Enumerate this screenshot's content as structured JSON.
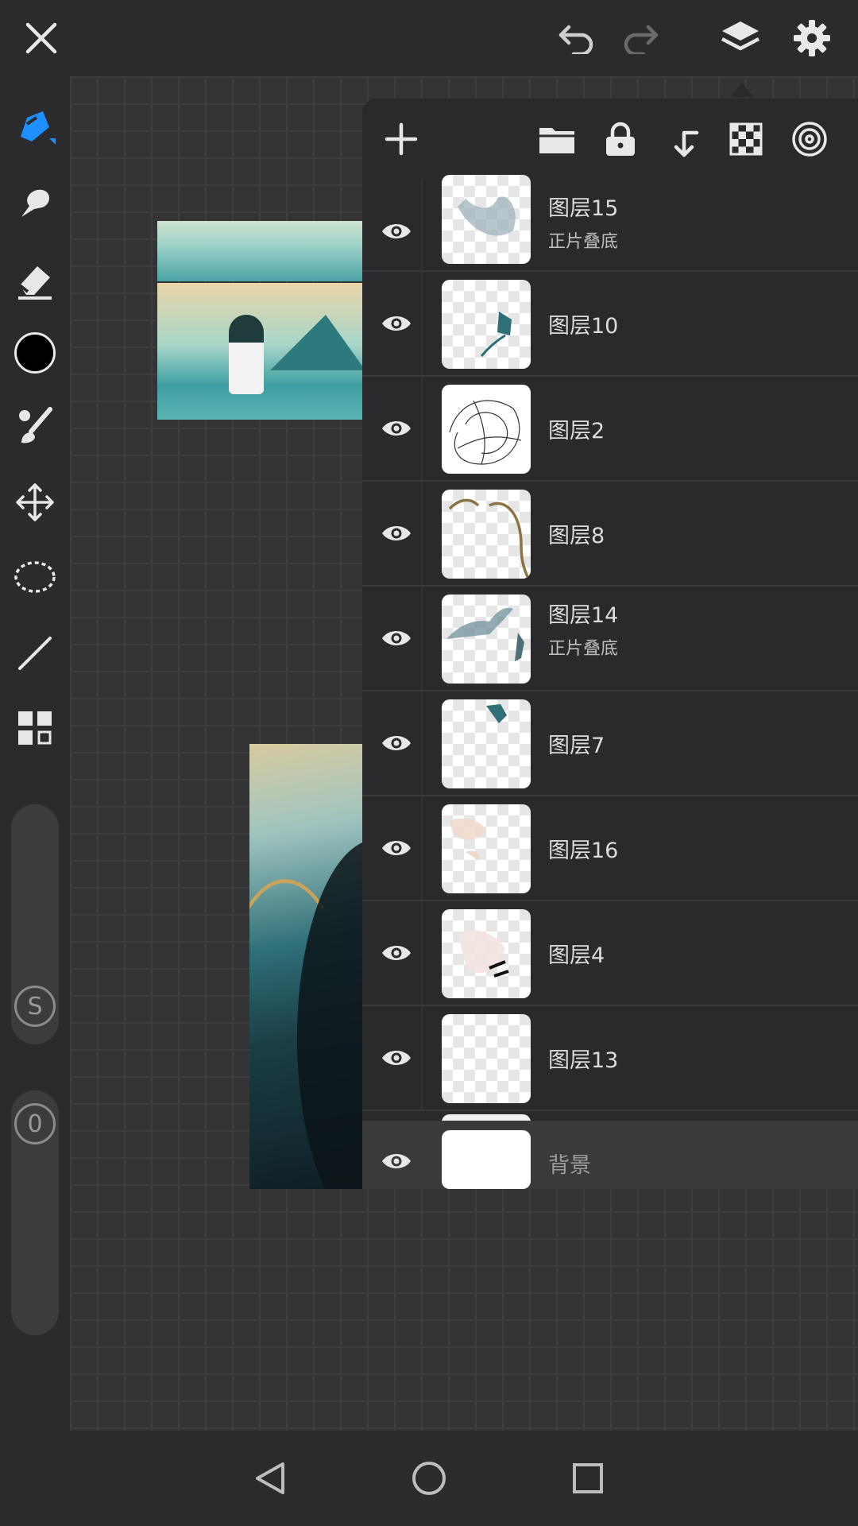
{
  "top_bar": {
    "icons": [
      "close-icon",
      "undo-icon",
      "redo-icon",
      "layers-icon",
      "settings-icon"
    ]
  },
  "toolbar": {
    "tools": [
      "brush-icon",
      "smudge-icon",
      "eraser-icon",
      "color-swatch",
      "paint-icon",
      "move-icon",
      "lasso-icon",
      "line-icon",
      "grid-icon"
    ],
    "active_tool": "brush-icon",
    "active_color": "#000000",
    "size_slider_label": "S",
    "opacity_slider_label": "0"
  },
  "layer_panel": {
    "toolbar_icons": [
      "add-icon",
      "folder-icon",
      "lock-icon",
      "merge-down-icon",
      "transparency-icon",
      "clipping-icon"
    ],
    "layers": [
      {
        "name": "图层15",
        "blend": "正片叠底",
        "visible": true
      },
      {
        "name": "图层10",
        "blend": "",
        "visible": true
      },
      {
        "name": "图层2",
        "blend": "",
        "visible": true
      },
      {
        "name": "图层8",
        "blend": "",
        "visible": true
      },
      {
        "name": "图层14",
        "blend": "正片叠底",
        "visible": true
      },
      {
        "name": "图层7",
        "blend": "",
        "visible": true
      },
      {
        "name": "图层16",
        "blend": "",
        "visible": true
      },
      {
        "name": "图层4",
        "blend": "",
        "visible": true
      },
      {
        "name": "图层13",
        "blend": "",
        "visible": true
      }
    ],
    "background_layer": {
      "name": "背景",
      "visible": true
    }
  },
  "nav_bar": {
    "icons": [
      "back-icon",
      "home-icon",
      "recents-icon"
    ]
  },
  "colors": {
    "accent": "#1e8fff",
    "panel_bg": "#2a2a2c",
    "app_bg": "#2b2b2d"
  }
}
